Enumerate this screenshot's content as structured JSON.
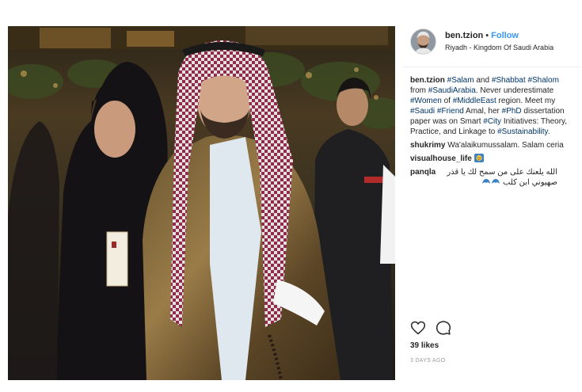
{
  "post": {
    "header": {
      "username": "ben.tzion",
      "separator": "•",
      "follow_label": "Follow",
      "location": "Riyadh - Kingdom Of Saudi Arabia"
    },
    "caption": {
      "username": "ben.tzion",
      "line1": [
        {
          "t": "#Salam",
          "tag": true
        },
        {
          "t": " and ",
          "tag": false
        },
        {
          "t": "#Shabbat",
          "tag": true
        },
        {
          "t": " ",
          "tag": false
        },
        {
          "t": "#Shalom",
          "tag": true
        }
      ],
      "line2": [
        {
          "t": "from ",
          "tag": false
        },
        {
          "t": "#SaudiArabia",
          "tag": true
        },
        {
          "t": ". Never underestimate",
          "tag": false
        }
      ],
      "line3": [
        {
          "t": "#Women",
          "tag": true
        },
        {
          "t": " of ",
          "tag": false
        },
        {
          "t": "#MiddleEast",
          "tag": true
        },
        {
          "t": " region. Meet my",
          "tag": false
        }
      ],
      "line4": [
        {
          "t": "#Saudi",
          "tag": true
        },
        {
          "t": " ",
          "tag": false
        },
        {
          "t": "#Friend",
          "tag": true
        },
        {
          "t": " Amal, her ",
          "tag": false
        },
        {
          "t": "#PhD",
          "tag": true
        },
        {
          "t": " dissertation",
          "tag": false
        }
      ],
      "line5": [
        {
          "t": "paper was on Smart ",
          "tag": false
        },
        {
          "t": "#City",
          "tag": true
        },
        {
          "t": " Initiatives: Theory,",
          "tag": false
        }
      ],
      "line6": [
        {
          "t": "Practice, and Linkage to ",
          "tag": false
        },
        {
          "t": "#Sustainability",
          "tag": true
        },
        {
          "t": ".",
          "tag": false
        }
      ]
    },
    "comments": [
      {
        "username": "shukrimy",
        "text": "Wa'alaikumussalam. Salam ceria"
      },
      {
        "username": "visualhouse_life",
        "text": ""
      },
      {
        "username": "panqla",
        "text_line1": "الله يلعنك على من سمح لك يا قذر",
        "text_line2": "صهيوني ابن كلب"
      }
    ],
    "actions": {
      "like_icon": "heart-icon",
      "comment_icon": "comment-bubble-icon"
    },
    "likes": "39 likes",
    "timestamp": "3 DAYS AGO",
    "colors": {
      "link": "#3897f0",
      "hashtag": "#003569",
      "text": "#262626",
      "muted": "#999999"
    }
  }
}
